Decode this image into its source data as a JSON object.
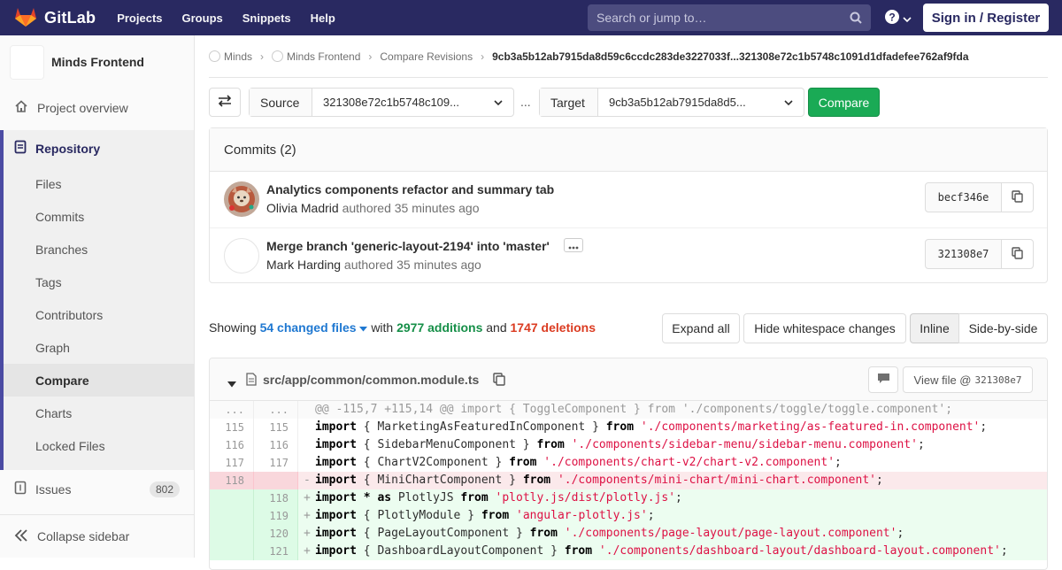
{
  "navbar": {
    "brand": "GitLab",
    "links": [
      "Projects",
      "Groups",
      "Snippets",
      "Help"
    ],
    "search_placeholder": "Search or jump to…",
    "signin": "Sign in / Register"
  },
  "sidebar": {
    "project_name": "Minds Frontend",
    "project_overview": "Project overview",
    "repository": "Repository",
    "repo_items": [
      "Files",
      "Commits",
      "Branches",
      "Tags",
      "Contributors",
      "Graph",
      "Compare",
      "Charts",
      "Locked Files"
    ],
    "active_item": "Compare",
    "issues": "Issues",
    "issues_count": "802",
    "collapse": "Collapse sidebar"
  },
  "breadcrumb": {
    "items": [
      "Minds",
      "Minds Frontend",
      "Compare Revisions"
    ],
    "current": "9cb3a5b12ab7915da8d59c6ccdc283de3227033f...321308e72c1b5748c1091d1dfadefee762af9fda"
  },
  "compare": {
    "source_label": "Source",
    "source_value": "321308e72c1b5748c109...",
    "ellipsis": "...",
    "target_label": "Target",
    "target_value": "9cb3a5b12ab7915da8d5...",
    "compare_button": "Compare"
  },
  "commits": {
    "header": "Commits (2)",
    "list": [
      {
        "title": "Analytics components refactor and summary tab",
        "author": "Olivia Madrid",
        "meta": "authored 35 minutes ago",
        "sha": "becf346e"
      },
      {
        "title": "Merge branch 'generic-layout-2194' into 'master'",
        "author": "Mark Harding",
        "meta": "authored 35 minutes ago",
        "sha": "321308e7"
      }
    ]
  },
  "diff_stats": {
    "showing": "Showing",
    "changed_files": "54 changed files",
    "with": "with",
    "additions": "2977 additions",
    "and": "and",
    "deletions": "1747 deletions"
  },
  "diff_buttons": {
    "expand_all": "Expand all",
    "hide_whitespace": "Hide whitespace changes",
    "inline": "Inline",
    "side_by_side": "Side-by-side"
  },
  "file": {
    "path": "src/app/common/common.module.ts",
    "view_file": "View file @",
    "view_sha": "321308e7",
    "lines": [
      {
        "type": "match",
        "old": "...",
        "new": "...",
        "sign": "",
        "code": "@@ -115,7 +115,14 @@ import { ToggleComponent } from './components/toggle/toggle.component';"
      },
      {
        "type": "context",
        "old": "115",
        "new": "115",
        "sign": " ",
        "code": "import { MarketingAsFeaturedInComponent } from './components/marketing/as-featured-in.component';"
      },
      {
        "type": "context",
        "old": "116",
        "new": "116",
        "sign": " ",
        "code": "import { SidebarMenuComponent } from './components/sidebar-menu/sidebar-menu.component';"
      },
      {
        "type": "context",
        "old": "117",
        "new": "117",
        "sign": " ",
        "code": "import { ChartV2Component } from './components/chart-v2/chart-v2.component';"
      },
      {
        "type": "old",
        "old": "118",
        "new": "",
        "sign": "-",
        "code": "import { MiniChartComponent } from './components/mini-chart/mini-chart.component';"
      },
      {
        "type": "new",
        "old": "",
        "new": "118",
        "sign": "+",
        "code": "import * as PlotlyJS from 'plotly.js/dist/plotly.js';"
      },
      {
        "type": "new",
        "old": "",
        "new": "119",
        "sign": "+",
        "code": "import { PlotlyModule } from 'angular-plotly.js';"
      },
      {
        "type": "new",
        "old": "",
        "new": "120",
        "sign": "+",
        "code": "import { PageLayoutComponent } from './components/page-layout/page-layout.component';"
      },
      {
        "type": "new",
        "old": "",
        "new": "121",
        "sign": "+",
        "code": "import { DashboardLayoutComponent } from './components/dashboard-layout/dashboard-layout.component';"
      }
    ]
  },
  "colors": {
    "navbar": "#292961",
    "accent": "#4b4ba3",
    "compare_green": "#1aaa55",
    "additions": "#168f48",
    "deletions": "#db3b21",
    "link": "#1f78d1"
  }
}
